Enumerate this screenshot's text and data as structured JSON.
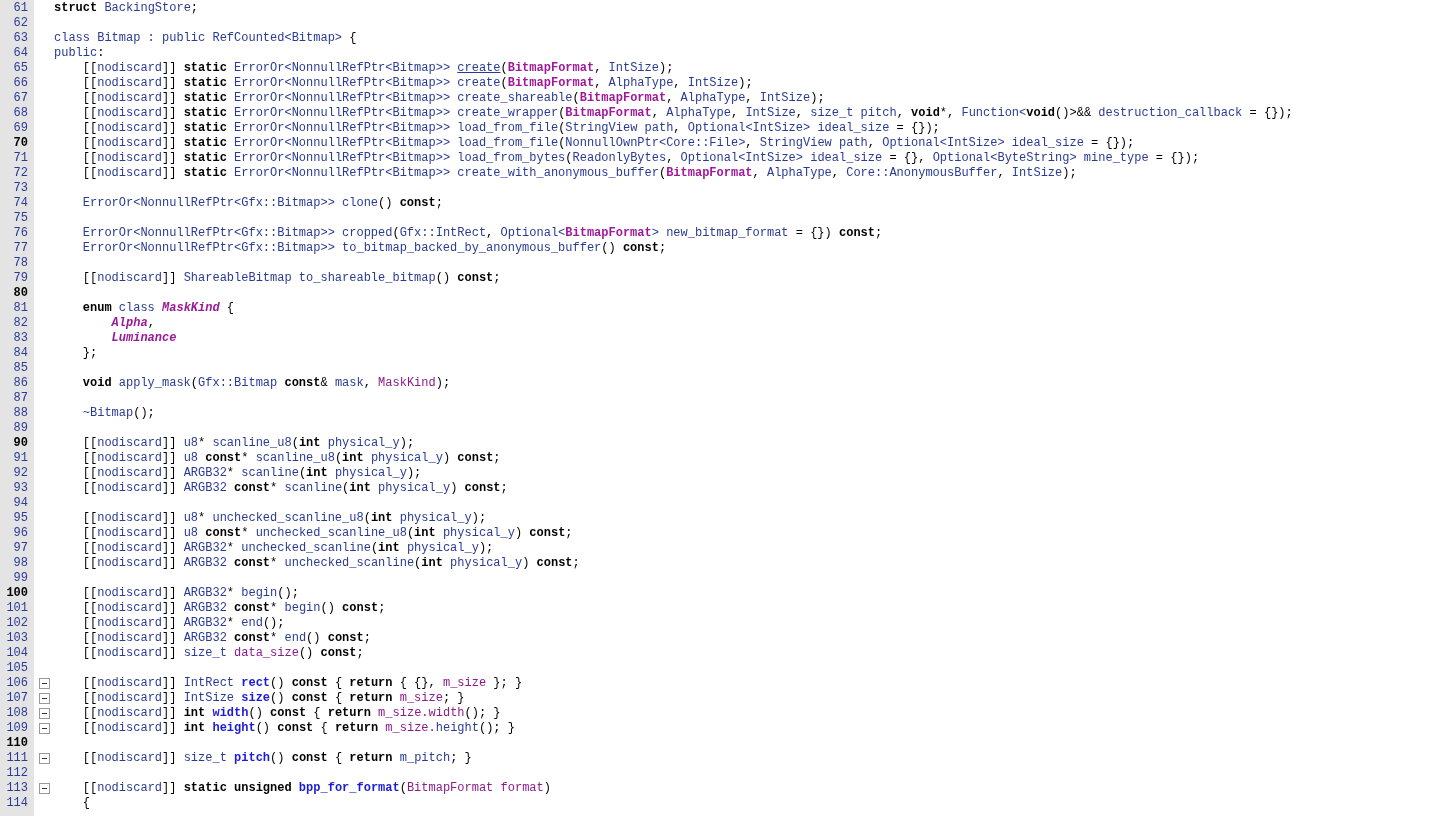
{
  "editor": {
    "lines": [
      {
        "number": "61",
        "emphasized": false,
        "fold": false,
        "tokens": [
          {
            "kind": "keyword",
            "text": "struct"
          },
          {
            "kind": "ident",
            "text": " BackingStore"
          },
          {
            "kind": "plain",
            "text": ";"
          }
        ]
      },
      {
        "number": "62",
        "emphasized": false,
        "fold": false
      },
      {
        "number": "63",
        "emphasized": false,
        "fold": false,
        "tokens": [
          {
            "kind": "ident",
            "text": "class Bitmap : public RefCounted<Bitmap>"
          },
          {
            "kind": "plain",
            "text": " {"
          }
        ]
      },
      {
        "number": "64",
        "emphasized": false,
        "fold": false,
        "tokens": [
          {
            "kind": "ident",
            "text": "public"
          },
          {
            "kind": "plain",
            "text": ":"
          }
        ]
      },
      {
        "number": "65",
        "emphasized": false,
        "fold": false,
        "tokens": [
          {
            "kind": "plain",
            "text": "    [["
          },
          {
            "kind": "ident",
            "text": "nodiscard"
          },
          {
            "kind": "plain",
            "text": "]] "
          },
          {
            "kind": "keyword",
            "text": "static"
          },
          {
            "kind": "ident",
            "text": " ErrorOr<NonnullRefPtr<Bitmap>> "
          },
          {
            "kind": "link",
            "text": "create"
          },
          {
            "kind": "plain",
            "text": "("
          },
          {
            "kind": "type",
            "text": "BitmapFormat"
          },
          {
            "kind": "plain",
            "text": ", "
          },
          {
            "kind": "ident",
            "text": "IntSize"
          },
          {
            "kind": "plain",
            "text": ");"
          }
        ]
      },
      {
        "number": "66",
        "emphasized": false,
        "fold": false,
        "tokens": [
          {
            "kind": "plain",
            "text": "    [["
          },
          {
            "kind": "ident",
            "text": "nodiscard"
          },
          {
            "kind": "plain",
            "text": "]] "
          },
          {
            "kind": "keyword",
            "text": "static"
          },
          {
            "kind": "ident",
            "text": " ErrorOr<NonnullRefPtr<Bitmap>> create"
          },
          {
            "kind": "plain",
            "text": "("
          },
          {
            "kind": "type",
            "text": "BitmapFormat"
          },
          {
            "kind": "plain",
            "text": ", "
          },
          {
            "kind": "ident",
            "text": "AlphaType"
          },
          {
            "kind": "plain",
            "text": ", "
          },
          {
            "kind": "ident",
            "text": "IntSize"
          },
          {
            "kind": "plain",
            "text": ");"
          }
        ]
      },
      {
        "number": "67",
        "emphasized": false,
        "fold": false,
        "tokens": [
          {
            "kind": "plain",
            "text": "    [["
          },
          {
            "kind": "ident",
            "text": "nodiscard"
          },
          {
            "kind": "plain",
            "text": "]] "
          },
          {
            "kind": "keyword",
            "text": "static"
          },
          {
            "kind": "ident",
            "text": " ErrorOr<NonnullRefPtr<Bitmap>> create_shareable"
          },
          {
            "kind": "plain",
            "text": "("
          },
          {
            "kind": "type",
            "text": "BitmapFormat"
          },
          {
            "kind": "plain",
            "text": ", "
          },
          {
            "kind": "ident",
            "text": "AlphaType"
          },
          {
            "kind": "plain",
            "text": ", "
          },
          {
            "kind": "ident",
            "text": "IntSize"
          },
          {
            "kind": "plain",
            "text": ");"
          }
        ]
      },
      {
        "number": "68",
        "emphasized": false,
        "fold": false,
        "tokens": [
          {
            "kind": "plain",
            "text": "    [["
          },
          {
            "kind": "ident",
            "text": "nodiscard"
          },
          {
            "kind": "plain",
            "text": "]] "
          },
          {
            "kind": "keyword",
            "text": "static"
          },
          {
            "kind": "ident",
            "text": " ErrorOr<NonnullRefPtr<Bitmap>> create_wrapper"
          },
          {
            "kind": "plain",
            "text": "("
          },
          {
            "kind": "type",
            "text": "BitmapFormat"
          },
          {
            "kind": "plain",
            "text": ", "
          },
          {
            "kind": "ident",
            "text": "AlphaType"
          },
          {
            "kind": "plain",
            "text": ", "
          },
          {
            "kind": "ident",
            "text": "IntSize"
          },
          {
            "kind": "plain",
            "text": ", "
          },
          {
            "kind": "ident",
            "text": "size_t pitch"
          },
          {
            "kind": "plain",
            "text": ", "
          },
          {
            "kind": "keyword",
            "text": "void"
          },
          {
            "kind": "plain",
            "text": "*, "
          },
          {
            "kind": "ident",
            "text": "Function<"
          },
          {
            "kind": "keyword",
            "text": "void"
          },
          {
            "kind": "plain",
            "text": "()>&& "
          },
          {
            "kind": "ident",
            "text": "destruction_callback"
          },
          {
            "kind": "plain",
            "text": " = {});"
          }
        ]
      },
      {
        "number": "69",
        "emphasized": false,
        "fold": false,
        "tokens": [
          {
            "kind": "plain",
            "text": "    [["
          },
          {
            "kind": "ident",
            "text": "nodiscard"
          },
          {
            "kind": "plain",
            "text": "]] "
          },
          {
            "kind": "keyword",
            "text": "static"
          },
          {
            "kind": "ident",
            "text": " ErrorOr<NonnullRefPtr<Bitmap>> load_from_file"
          },
          {
            "kind": "plain",
            "text": "("
          },
          {
            "kind": "ident",
            "text": "StringView path"
          },
          {
            "kind": "plain",
            "text": ", "
          },
          {
            "kind": "ident",
            "text": "Optional<IntSize> ideal_size"
          },
          {
            "kind": "plain",
            "text": " = {});"
          }
        ]
      },
      {
        "number": "70",
        "emphasized": true,
        "fold": false,
        "tokens": [
          {
            "kind": "plain",
            "text": "    [["
          },
          {
            "kind": "ident",
            "text": "nodiscard"
          },
          {
            "kind": "plain",
            "text": "]] "
          },
          {
            "kind": "keyword",
            "text": "static"
          },
          {
            "kind": "ident",
            "text": " ErrorOr<NonnullRefPtr<Bitmap>> load_from_file"
          },
          {
            "kind": "plain",
            "text": "("
          },
          {
            "kind": "ident",
            "text": "NonnullOwnPtr<Core::File>"
          },
          {
            "kind": "plain",
            "text": ", "
          },
          {
            "kind": "ident",
            "text": "StringView path"
          },
          {
            "kind": "plain",
            "text": ", "
          },
          {
            "kind": "ident",
            "text": "Optional<IntSize> ideal_size"
          },
          {
            "kind": "plain",
            "text": " = {});"
          }
        ]
      },
      {
        "number": "71",
        "emphasized": false,
        "fold": false,
        "tokens": [
          {
            "kind": "plain",
            "text": "    [["
          },
          {
            "kind": "ident",
            "text": "nodiscard"
          },
          {
            "kind": "plain",
            "text": "]] "
          },
          {
            "kind": "keyword",
            "text": "static"
          },
          {
            "kind": "ident",
            "text": " ErrorOr<NonnullRefPtr<Bitmap>> load_from_bytes"
          },
          {
            "kind": "plain",
            "text": "("
          },
          {
            "kind": "ident",
            "text": "ReadonlyBytes"
          },
          {
            "kind": "plain",
            "text": ", "
          },
          {
            "kind": "ident",
            "text": "Optional<IntSize> ideal_size"
          },
          {
            "kind": "plain",
            "text": " = {}, "
          },
          {
            "kind": "ident",
            "text": "Optional<ByteString> mine_type"
          },
          {
            "kind": "plain",
            "text": " = {});"
          }
        ]
      },
      {
        "number": "72",
        "emphasized": false,
        "fold": false,
        "tokens": [
          {
            "kind": "plain",
            "text": "    [["
          },
          {
            "kind": "ident",
            "text": "nodiscard"
          },
          {
            "kind": "plain",
            "text": "]] "
          },
          {
            "kind": "keyword",
            "text": "static"
          },
          {
            "kind": "ident",
            "text": " ErrorOr<NonnullRefPtr<Bitmap>> create_with_anonymous_buffer"
          },
          {
            "kind": "plain",
            "text": "("
          },
          {
            "kind": "type",
            "text": "BitmapFormat"
          },
          {
            "kind": "plain",
            "text": ", "
          },
          {
            "kind": "ident",
            "text": "AlphaType"
          },
          {
            "kind": "plain",
            "text": ", "
          },
          {
            "kind": "ident",
            "text": "Core::AnonymousBuffer"
          },
          {
            "kind": "plain",
            "text": ", "
          },
          {
            "kind": "ident",
            "text": "IntSize"
          },
          {
            "kind": "plain",
            "text": ");"
          }
        ]
      },
      {
        "number": "73",
        "emphasized": false,
        "fold": false
      },
      {
        "number": "74",
        "emphasized": false,
        "fold": false,
        "tokens": [
          {
            "kind": "ident",
            "text": "    ErrorOr<NonnullRefPtr<Gfx::Bitmap>> clone"
          },
          {
            "kind": "plain",
            "text": "() "
          },
          {
            "kind": "keyword",
            "text": "const"
          },
          {
            "kind": "plain",
            "text": ";"
          }
        ]
      },
      {
        "number": "75",
        "emphasized": false,
        "fold": false
      },
      {
        "number": "76",
        "emphasized": false,
        "fold": false,
        "tokens": [
          {
            "kind": "ident",
            "text": "    ErrorOr<NonnullRefPtr<Gfx::Bitmap>> cropped"
          },
          {
            "kind": "plain",
            "text": "("
          },
          {
            "kind": "ident",
            "text": "Gfx::IntRect"
          },
          {
            "kind": "plain",
            "text": ", "
          },
          {
            "kind": "ident",
            "text": "Optional<"
          },
          {
            "kind": "type",
            "text": "BitmapFormat"
          },
          {
            "kind": "ident",
            "text": "> new_bitmap_format"
          },
          {
            "kind": "plain",
            "text": " = {}) "
          },
          {
            "kind": "keyword",
            "text": "const"
          },
          {
            "kind": "plain",
            "text": ";"
          }
        ]
      },
      {
        "number": "77",
        "emphasized": false,
        "fold": false,
        "tokens": [
          {
            "kind": "ident",
            "text": "    ErrorOr<NonnullRefPtr<Gfx::Bitmap>> to_bitmap_backed_by_anonymous_buffer"
          },
          {
            "kind": "plain",
            "text": "() "
          },
          {
            "kind": "keyword",
            "text": "const"
          },
          {
            "kind": "plain",
            "text": ";"
          }
        ]
      },
      {
        "number": "78",
        "emphasized": false,
        "fold": false
      },
      {
        "number": "79",
        "emphasized": false,
        "fold": false,
        "tokens": [
          {
            "kind": "plain",
            "text": "    [["
          },
          {
            "kind": "ident",
            "text": "nodiscard"
          },
          {
            "kind": "plain",
            "text": "]] "
          },
          {
            "kind": "ident",
            "text": "ShareableBitmap to_shareable_bitmap"
          },
          {
            "kind": "plain",
            "text": "() "
          },
          {
            "kind": "keyword",
            "text": "const"
          },
          {
            "kind": "plain",
            "text": ";"
          }
        ]
      },
      {
        "number": "80",
        "emphasized": true,
        "fold": false
      },
      {
        "number": "81",
        "emphasized": false,
        "fold": false,
        "tokens": [
          {
            "kind": "keyword",
            "text": "    enum"
          },
          {
            "kind": "ident",
            "text": " class "
          },
          {
            "kind": "enum",
            "text": "MaskKind"
          },
          {
            "kind": "plain",
            "text": " {"
          }
        ]
      },
      {
        "number": "82",
        "emphasized": false,
        "fold": false,
        "tokens": [
          {
            "kind": "enum",
            "text": "        Alpha"
          },
          {
            "kind": "plain",
            "text": ","
          }
        ]
      },
      {
        "number": "83",
        "emphasized": false,
        "fold": false,
        "tokens": [
          {
            "kind": "enum",
            "text": "        Luminance"
          }
        ]
      },
      {
        "number": "84",
        "emphasized": false,
        "fold": false,
        "tokens": [
          {
            "kind": "plain",
            "text": "    };"
          }
        ]
      },
      {
        "number": "85",
        "emphasized": false,
        "fold": false
      },
      {
        "number": "86",
        "emphasized": false,
        "fold": false,
        "tokens": [
          {
            "kind": "keyword",
            "text": "    void"
          },
          {
            "kind": "ident",
            "text": " apply_mask"
          },
          {
            "kind": "plain",
            "text": "("
          },
          {
            "kind": "ident",
            "text": "Gfx::Bitmap "
          },
          {
            "kind": "keyword",
            "text": "const"
          },
          {
            "kind": "plain",
            "text": "& "
          },
          {
            "kind": "ident",
            "text": "mask"
          },
          {
            "kind": "plain",
            "text": ", "
          },
          {
            "kind": "member",
            "text": "MaskKind"
          },
          {
            "kind": "plain",
            "text": ");"
          }
        ]
      },
      {
        "number": "87",
        "emphasized": false,
        "fold": false
      },
      {
        "number": "88",
        "emphasized": false,
        "fold": false,
        "tokens": [
          {
            "kind": "ident",
            "text": "    ~Bitmap"
          },
          {
            "kind": "plain",
            "text": "();"
          }
        ]
      },
      {
        "number": "89",
        "emphasized": false,
        "fold": false
      },
      {
        "number": "90",
        "emphasized": true,
        "fold": false,
        "tokens": [
          {
            "kind": "plain",
            "text": "    [["
          },
          {
            "kind": "ident",
            "text": "nodiscard"
          },
          {
            "kind": "plain",
            "text": "]] "
          },
          {
            "kind": "ident",
            "text": "u8"
          },
          {
            "kind": "plain",
            "text": "* "
          },
          {
            "kind": "ident",
            "text": "scanline_u8"
          },
          {
            "kind": "plain",
            "text": "("
          },
          {
            "kind": "keyword",
            "text": "int"
          },
          {
            "kind": "ident",
            "text": " physical_y"
          },
          {
            "kind": "plain",
            "text": ");"
          }
        ]
      },
      {
        "number": "91",
        "emphasized": false,
        "fold": false,
        "tokens": [
          {
            "kind": "plain",
            "text": "    [["
          },
          {
            "kind": "ident",
            "text": "nodiscard"
          },
          {
            "kind": "plain",
            "text": "]] "
          },
          {
            "kind": "ident",
            "text": "u8 "
          },
          {
            "kind": "keyword",
            "text": "const"
          },
          {
            "kind": "plain",
            "text": "* "
          },
          {
            "kind": "ident",
            "text": "scanline_u8"
          },
          {
            "kind": "plain",
            "text": "("
          },
          {
            "kind": "keyword",
            "text": "int"
          },
          {
            "kind": "ident",
            "text": " physical_y"
          },
          {
            "kind": "plain",
            "text": ") "
          },
          {
            "kind": "keyword",
            "text": "const"
          },
          {
            "kind": "plain",
            "text": ";"
          }
        ]
      },
      {
        "number": "92",
        "emphasized": false,
        "fold": false,
        "tokens": [
          {
            "kind": "plain",
            "text": "    [["
          },
          {
            "kind": "ident",
            "text": "nodiscard"
          },
          {
            "kind": "plain",
            "text": "]] "
          },
          {
            "kind": "ident",
            "text": "ARGB32"
          },
          {
            "kind": "plain",
            "text": "* "
          },
          {
            "kind": "ident",
            "text": "scanline"
          },
          {
            "kind": "plain",
            "text": "("
          },
          {
            "kind": "keyword",
            "text": "int"
          },
          {
            "kind": "ident",
            "text": " physical_y"
          },
          {
            "kind": "plain",
            "text": ");"
          }
        ]
      },
      {
        "number": "93",
        "emphasized": false,
        "fold": false,
        "tokens": [
          {
            "kind": "plain",
            "text": "    [["
          },
          {
            "kind": "ident",
            "text": "nodiscard"
          },
          {
            "kind": "plain",
            "text": "]] "
          },
          {
            "kind": "ident",
            "text": "ARGB32 "
          },
          {
            "kind": "keyword",
            "text": "const"
          },
          {
            "kind": "plain",
            "text": "* "
          },
          {
            "kind": "ident",
            "text": "scanline"
          },
          {
            "kind": "plain",
            "text": "("
          },
          {
            "kind": "keyword",
            "text": "int"
          },
          {
            "kind": "ident",
            "text": " physical_y"
          },
          {
            "kind": "plain",
            "text": ") "
          },
          {
            "kind": "keyword",
            "text": "const"
          },
          {
            "kind": "plain",
            "text": ";"
          }
        ]
      },
      {
        "number": "94",
        "emphasized": false,
        "fold": false
      },
      {
        "number": "95",
        "emphasized": false,
        "fold": false,
        "tokens": [
          {
            "kind": "plain",
            "text": "    [["
          },
          {
            "kind": "ident",
            "text": "nodiscard"
          },
          {
            "kind": "plain",
            "text": "]] "
          },
          {
            "kind": "ident",
            "text": "u8"
          },
          {
            "kind": "plain",
            "text": "* "
          },
          {
            "kind": "ident",
            "text": "unchecked_scanline_u8"
          },
          {
            "kind": "plain",
            "text": "("
          },
          {
            "kind": "keyword",
            "text": "int"
          },
          {
            "kind": "ident",
            "text": " physical_y"
          },
          {
            "kind": "plain",
            "text": ");"
          }
        ]
      },
      {
        "number": "96",
        "emphasized": false,
        "fold": false,
        "tokens": [
          {
            "kind": "plain",
            "text": "    [["
          },
          {
            "kind": "ident",
            "text": "nodiscard"
          },
          {
            "kind": "plain",
            "text": "]] "
          },
          {
            "kind": "ident",
            "text": "u8 "
          },
          {
            "kind": "keyword",
            "text": "const"
          },
          {
            "kind": "plain",
            "text": "* "
          },
          {
            "kind": "ident",
            "text": "unchecked_scanline_u8"
          },
          {
            "kind": "plain",
            "text": "("
          },
          {
            "kind": "keyword",
            "text": "int"
          },
          {
            "kind": "ident",
            "text": " physical_y"
          },
          {
            "kind": "plain",
            "text": ") "
          },
          {
            "kind": "keyword",
            "text": "const"
          },
          {
            "kind": "plain",
            "text": ";"
          }
        ]
      },
      {
        "number": "97",
        "emphasized": false,
        "fold": false,
        "tokens": [
          {
            "kind": "plain",
            "text": "    [["
          },
          {
            "kind": "ident",
            "text": "nodiscard"
          },
          {
            "kind": "plain",
            "text": "]] "
          },
          {
            "kind": "ident",
            "text": "ARGB32"
          },
          {
            "kind": "plain",
            "text": "* "
          },
          {
            "kind": "ident",
            "text": "unchecked_scanline"
          },
          {
            "kind": "plain",
            "text": "("
          },
          {
            "kind": "keyword",
            "text": "int"
          },
          {
            "kind": "ident",
            "text": " physical_y"
          },
          {
            "kind": "plain",
            "text": ");"
          }
        ]
      },
      {
        "number": "98",
        "emphasized": false,
        "fold": false,
        "tokens": [
          {
            "kind": "plain",
            "text": "    [["
          },
          {
            "kind": "ident",
            "text": "nodiscard"
          },
          {
            "kind": "plain",
            "text": "]] "
          },
          {
            "kind": "ident",
            "text": "ARGB32 "
          },
          {
            "kind": "keyword",
            "text": "const"
          },
          {
            "kind": "plain",
            "text": "* "
          },
          {
            "kind": "ident",
            "text": "unchecked_scanline"
          },
          {
            "kind": "plain",
            "text": "("
          },
          {
            "kind": "keyword",
            "text": "int"
          },
          {
            "kind": "ident",
            "text": " physical_y"
          },
          {
            "kind": "plain",
            "text": ") "
          },
          {
            "kind": "keyword",
            "text": "const"
          },
          {
            "kind": "plain",
            "text": ";"
          }
        ]
      },
      {
        "number": "99",
        "emphasized": false,
        "fold": false
      },
      {
        "number": "100",
        "emphasized": true,
        "fold": false,
        "tokens": [
          {
            "kind": "plain",
            "text": "    [["
          },
          {
            "kind": "ident",
            "text": "nodiscard"
          },
          {
            "kind": "plain",
            "text": "]] "
          },
          {
            "kind": "ident",
            "text": "ARGB32"
          },
          {
            "kind": "plain",
            "text": "* "
          },
          {
            "kind": "ident",
            "text": "begin"
          },
          {
            "kind": "plain",
            "text": "();"
          }
        ]
      },
      {
        "number": "101",
        "emphasized": false,
        "fold": false,
        "tokens": [
          {
            "kind": "plain",
            "text": "    [["
          },
          {
            "kind": "ident",
            "text": "nodiscard"
          },
          {
            "kind": "plain",
            "text": "]] "
          },
          {
            "kind": "ident",
            "text": "ARGB32 "
          },
          {
            "kind": "keyword",
            "text": "const"
          },
          {
            "kind": "plain",
            "text": "* "
          },
          {
            "kind": "ident",
            "text": "begin"
          },
          {
            "kind": "plain",
            "text": "() "
          },
          {
            "kind": "keyword",
            "text": "const"
          },
          {
            "kind": "plain",
            "text": ";"
          }
        ]
      },
      {
        "number": "102",
        "emphasized": false,
        "fold": false,
        "tokens": [
          {
            "kind": "plain",
            "text": "    [["
          },
          {
            "kind": "ident",
            "text": "nodiscard"
          },
          {
            "kind": "plain",
            "text": "]] "
          },
          {
            "kind": "ident",
            "text": "ARGB32"
          },
          {
            "kind": "plain",
            "text": "* "
          },
          {
            "kind": "ident",
            "text": "end"
          },
          {
            "kind": "plain",
            "text": "();"
          }
        ]
      },
      {
        "number": "103",
        "emphasized": false,
        "fold": false,
        "tokens": [
          {
            "kind": "plain",
            "text": "    [["
          },
          {
            "kind": "ident",
            "text": "nodiscard"
          },
          {
            "kind": "plain",
            "text": "]] "
          },
          {
            "kind": "ident",
            "text": "ARGB32 "
          },
          {
            "kind": "keyword",
            "text": "const"
          },
          {
            "kind": "plain",
            "text": "* "
          },
          {
            "kind": "ident",
            "text": "end"
          },
          {
            "kind": "plain",
            "text": "() "
          },
          {
            "kind": "keyword",
            "text": "const"
          },
          {
            "kind": "plain",
            "text": ";"
          }
        ]
      },
      {
        "number": "104",
        "emphasized": false,
        "fold": false,
        "tokens": [
          {
            "kind": "plain",
            "text": "    [["
          },
          {
            "kind": "ident",
            "text": "nodiscard"
          },
          {
            "kind": "plain",
            "text": "]] "
          },
          {
            "kind": "ident",
            "text": "size_t "
          },
          {
            "kind": "member",
            "text": "data_size"
          },
          {
            "kind": "plain",
            "text": "() "
          },
          {
            "kind": "keyword",
            "text": "const"
          },
          {
            "kind": "plain",
            "text": ";"
          }
        ]
      },
      {
        "number": "105",
        "emphasized": false,
        "fold": false
      },
      {
        "number": "106",
        "emphasized": false,
        "fold": true,
        "tokens": [
          {
            "kind": "plain",
            "text": "    [["
          },
          {
            "kind": "ident",
            "text": "nodiscard"
          },
          {
            "kind": "plain",
            "text": "]] "
          },
          {
            "kind": "ident",
            "text": "IntRect "
          },
          {
            "kind": "func",
            "text": "rect"
          },
          {
            "kind": "plain",
            "text": "() "
          },
          {
            "kind": "keyword",
            "text": "const"
          },
          {
            "kind": "plain",
            "text": " { "
          },
          {
            "kind": "keyword",
            "text": "return"
          },
          {
            "kind": "plain",
            "text": " { {}, "
          },
          {
            "kind": "member",
            "text": "m_size"
          },
          {
            "kind": "plain",
            "text": " }; }"
          }
        ]
      },
      {
        "number": "107",
        "emphasized": false,
        "fold": true,
        "tokens": [
          {
            "kind": "plain",
            "text": "    [["
          },
          {
            "kind": "ident",
            "text": "nodiscard"
          },
          {
            "kind": "plain",
            "text": "]] "
          },
          {
            "kind": "ident",
            "text": "IntSize "
          },
          {
            "kind": "func",
            "text": "size"
          },
          {
            "kind": "plain",
            "text": "() "
          },
          {
            "kind": "keyword",
            "text": "const"
          },
          {
            "kind": "plain",
            "text": " { "
          },
          {
            "kind": "keyword",
            "text": "return"
          },
          {
            "kind": "member",
            "text": " m_size"
          },
          {
            "kind": "plain",
            "text": "; }"
          }
        ]
      },
      {
        "number": "108",
        "emphasized": false,
        "fold": true,
        "tokens": [
          {
            "kind": "plain",
            "text": "    [["
          },
          {
            "kind": "ident",
            "text": "nodiscard"
          },
          {
            "kind": "plain",
            "text": "]] "
          },
          {
            "kind": "keyword",
            "text": "int"
          },
          {
            "kind": "func",
            "text": " width"
          },
          {
            "kind": "plain",
            "text": "() "
          },
          {
            "kind": "keyword",
            "text": "const"
          },
          {
            "kind": "plain",
            "text": " { "
          },
          {
            "kind": "keyword",
            "text": "return"
          },
          {
            "kind": "member",
            "text": " m_size.width"
          },
          {
            "kind": "plain",
            "text": "(); }"
          }
        ]
      },
      {
        "number": "109",
        "emphasized": false,
        "fold": true,
        "tokens": [
          {
            "kind": "plain",
            "text": "    [["
          },
          {
            "kind": "ident",
            "text": "nodiscard"
          },
          {
            "kind": "plain",
            "text": "]] "
          },
          {
            "kind": "keyword",
            "text": "int"
          },
          {
            "kind": "func",
            "text": " height"
          },
          {
            "kind": "plain",
            "text": "() "
          },
          {
            "kind": "keyword",
            "text": "const"
          },
          {
            "kind": "plain",
            "text": " { "
          },
          {
            "kind": "keyword",
            "text": "return"
          },
          {
            "kind": "member",
            "text": " m_size."
          },
          {
            "kind": "ident",
            "text": "height"
          },
          {
            "kind": "plain",
            "text": "(); }"
          }
        ]
      },
      {
        "number": "110",
        "emphasized": true,
        "fold": false
      },
      {
        "number": "111",
        "emphasized": false,
        "fold": true,
        "tokens": [
          {
            "kind": "plain",
            "text": "    [["
          },
          {
            "kind": "ident",
            "text": "nodiscard"
          },
          {
            "kind": "plain",
            "text": "]] "
          },
          {
            "kind": "ident",
            "text": "size_t "
          },
          {
            "kind": "func",
            "text": "pitch"
          },
          {
            "kind": "plain",
            "text": "() "
          },
          {
            "kind": "keyword",
            "text": "const"
          },
          {
            "kind": "plain",
            "text": " { "
          },
          {
            "kind": "keyword",
            "text": "return"
          },
          {
            "kind": "ident",
            "text": " m_pitch"
          },
          {
            "kind": "plain",
            "text": "; }"
          }
        ]
      },
      {
        "number": "112",
        "emphasized": false,
        "fold": false
      },
      {
        "number": "113",
        "emphasized": false,
        "fold": true,
        "tokens": [
          {
            "kind": "plain",
            "text": "    [["
          },
          {
            "kind": "ident",
            "text": "nodiscard"
          },
          {
            "kind": "plain",
            "text": "]] "
          },
          {
            "kind": "keyword",
            "text": "static unsigned"
          },
          {
            "kind": "func",
            "text": " bpp_for_format"
          },
          {
            "kind": "plain",
            "text": "("
          },
          {
            "kind": "member",
            "text": "BitmapFormat format"
          },
          {
            "kind": "plain",
            "text": ")"
          }
        ]
      },
      {
        "number": "114",
        "emphasized": false,
        "fold": false,
        "tokens": [
          {
            "kind": "plain",
            "text": "    {"
          }
        ]
      }
    ]
  }
}
